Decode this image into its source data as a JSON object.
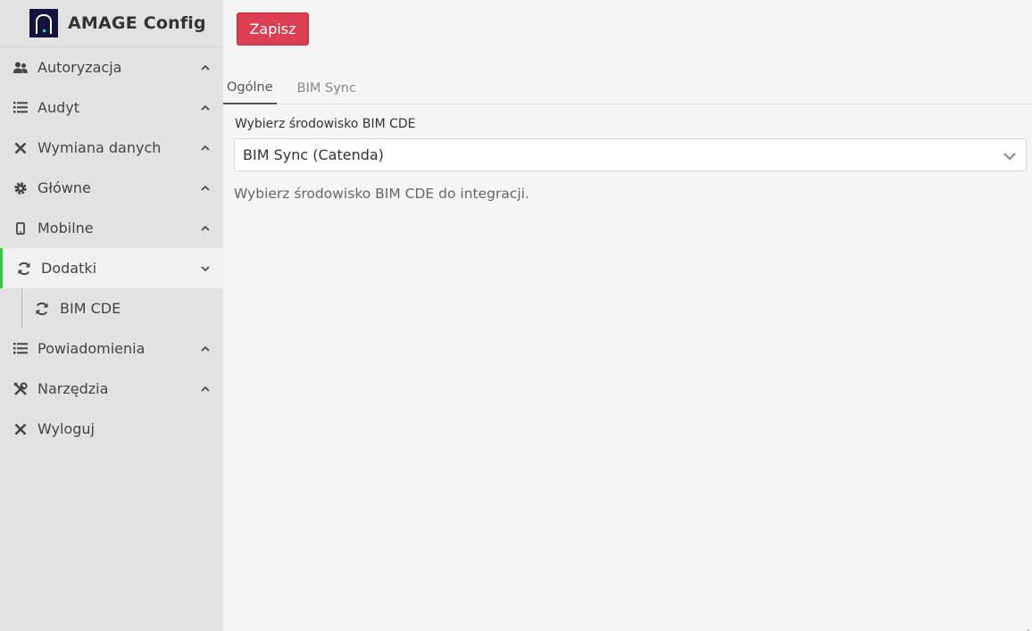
{
  "app": {
    "title": "AMAGE Config"
  },
  "sidebar": {
    "items": [
      {
        "label": "Autoryzacja",
        "icon": "users-icon",
        "expanded": false
      },
      {
        "label": "Audyt",
        "icon": "list-icon",
        "expanded": false
      },
      {
        "label": "Wymiana danych",
        "icon": "close-x-icon",
        "expanded": false
      },
      {
        "label": "Główne",
        "icon": "gear-icon",
        "expanded": false
      },
      {
        "label": "Mobilne",
        "icon": "mobile-icon",
        "expanded": false
      },
      {
        "label": "Dodatki",
        "icon": "sync-icon",
        "expanded": true,
        "active": true
      },
      {
        "label": "Powiadomienia",
        "icon": "list-icon",
        "expanded": false
      },
      {
        "label": "Narzędzia",
        "icon": "tools-icon",
        "expanded": false
      },
      {
        "label": "Wyloguj",
        "icon": "close-x-icon"
      }
    ],
    "subitems": [
      {
        "label": "BIM CDE",
        "icon": "sync-icon"
      }
    ]
  },
  "toolbar": {
    "save_label": "Zapisz"
  },
  "tabs": [
    {
      "label": "Ogólne",
      "active": true
    },
    {
      "label": "BIM Sync",
      "active": false
    }
  ],
  "form": {
    "env_label": "Wybierz środowisko BIM CDE",
    "env_value": "BIM Sync (Catenda)",
    "env_help": "Wybierz środowisko BIM CDE do integracji."
  },
  "colors": {
    "accent": "#dc3f52",
    "active_indicator": "#2ecc40",
    "sidebar_bg": "#e2e2e2",
    "logo_bg": "#14143e"
  }
}
